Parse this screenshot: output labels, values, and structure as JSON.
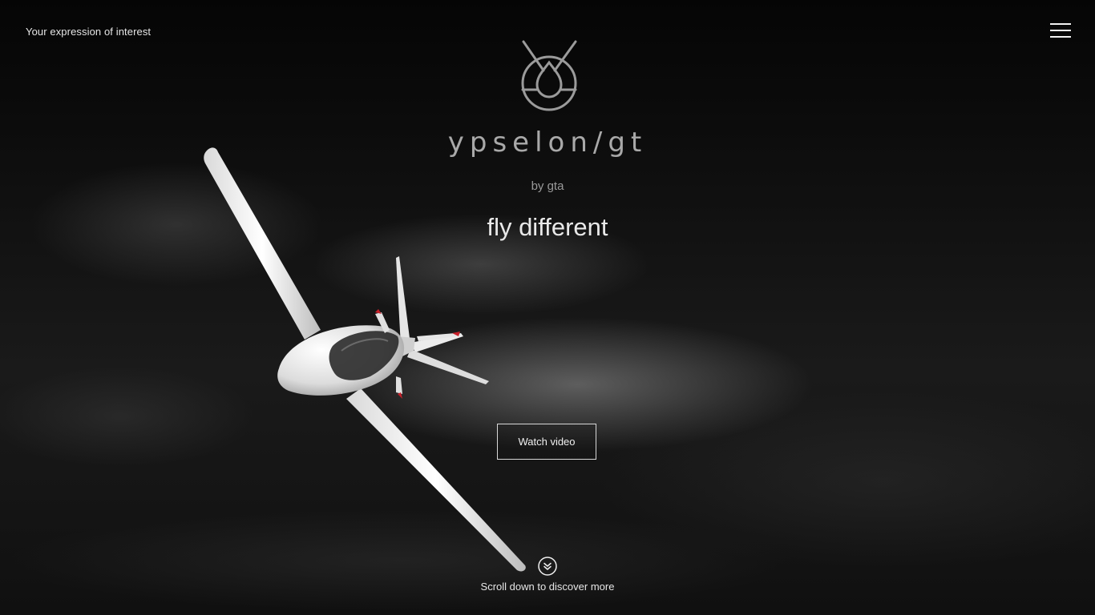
{
  "header": {
    "interest_link": "Your expression of interest",
    "menu_icon": "hamburger-menu-icon"
  },
  "brand": {
    "emblem_icon": "ypselon-emblem-icon",
    "wordmark": "ypselon/gt",
    "byline": "by gta",
    "tagline": "fly different"
  },
  "hero": {
    "watch_video_label": "Watch video",
    "scroll_icon": "chevron-double-down-circle-icon",
    "scroll_text": "Scroll down to discover more"
  },
  "colors": {
    "background": "#0b0b0b",
    "text_primary": "#e9e9e9",
    "text_muted": "#9a9a9a",
    "accent_red": "#c8202a"
  }
}
